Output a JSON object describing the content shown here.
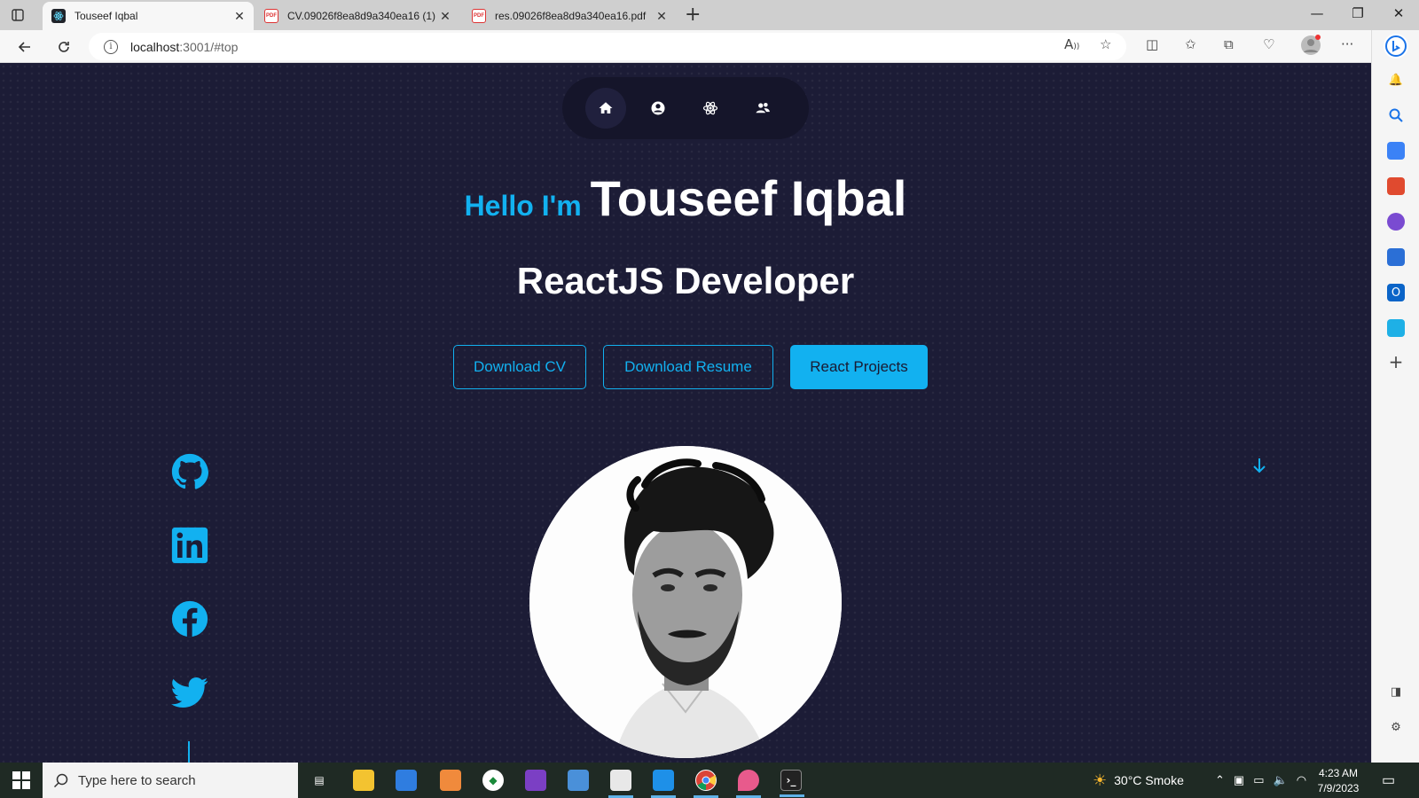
{
  "browser": {
    "tabs": [
      {
        "title": "Touseef Iqbal",
        "active": true,
        "favicon": "react-icon"
      },
      {
        "title": "CV.09026f8ea8d9a340ea16 (1).pdf",
        "active": false,
        "favicon": "pdf-icon"
      },
      {
        "title": "res.09026f8ea8d9a340ea16.pdf",
        "active": false,
        "favicon": "pdf-icon"
      }
    ],
    "url_host": "localhost",
    "url_path": ":3001/#top"
  },
  "nav": {
    "items": [
      {
        "name": "home-icon",
        "active": true
      },
      {
        "name": "user-icon",
        "active": false
      },
      {
        "name": "react-icon",
        "active": false
      },
      {
        "name": "users-icon",
        "active": false
      }
    ]
  },
  "hero": {
    "greeting": "Hello I'm",
    "name": "Touseef Iqbal",
    "role": "ReactJS Developer",
    "buttons": {
      "cv": "Download CV",
      "resume": "Download Resume",
      "projects": "React Projects"
    }
  },
  "socials": [
    "github-icon",
    "linkedin-icon",
    "facebook-icon",
    "twitter-icon"
  ],
  "taskbar": {
    "search_placeholder": "Type here to search",
    "weather": "30°C  Smoke",
    "time": "4:23 AM",
    "date": "7/9/2023"
  },
  "colors": {
    "accent": "#12b1f0",
    "page_bg": "#1c1c36",
    "nav_bg": "#15152a"
  }
}
